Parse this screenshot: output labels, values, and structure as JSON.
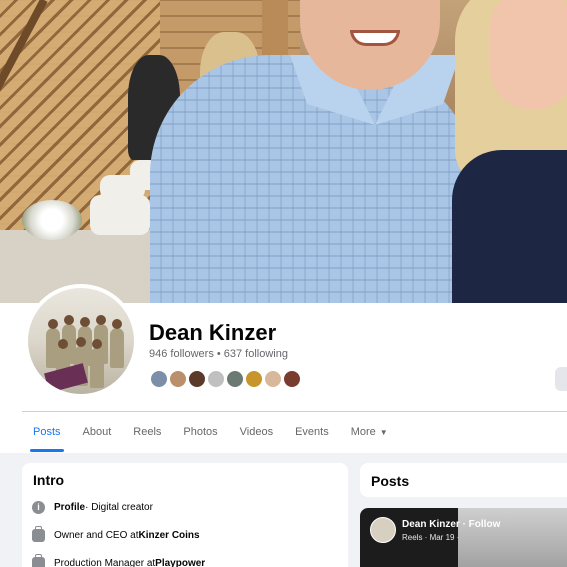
{
  "profile": {
    "name": "Dean Kinzer",
    "followers_line": "946 followers • 637 following"
  },
  "tabs": [
    {
      "label": "Posts",
      "active": true
    },
    {
      "label": "About"
    },
    {
      "label": "Reels"
    },
    {
      "label": "Photos"
    },
    {
      "label": "Videos"
    },
    {
      "label": "Events"
    },
    {
      "label": "More",
      "icon": "caret-down-icon"
    }
  ],
  "intro": {
    "title": "Intro",
    "rows": [
      {
        "icon": "info-icon",
        "bold": "Profile",
        "text": " · Digital creator"
      },
      {
        "icon": "briefcase-icon",
        "text": "Owner and CEO at ",
        "bold": "Kinzer Coins"
      },
      {
        "icon": "briefcase-icon",
        "text": "Production Manager at ",
        "bold": "Playpower"
      }
    ]
  },
  "posts": {
    "title": "Posts",
    "reel": {
      "author": "Dean Kinzer",
      "follow": " · Follow",
      "sub": "Reels · Mar 19 ·"
    }
  },
  "colors": {
    "accent": "#1877f2",
    "background": "#f0f2f5",
    "text": "#050505",
    "muted": "#65676b"
  }
}
